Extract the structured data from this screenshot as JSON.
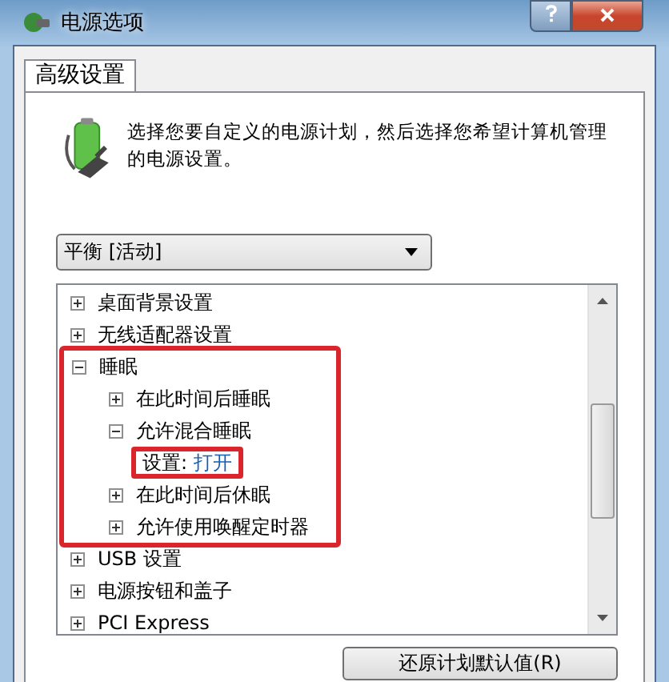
{
  "window": {
    "title": "电源选项"
  },
  "tabs": [
    {
      "label": "高级设置",
      "selected": true
    }
  ],
  "description": "选择您要自定义的电源计划，然后选择您希望计算机管理的电源设置。",
  "plan_select": {
    "value": "平衡 [活动]"
  },
  "settings_tree": [
    {
      "kind": "group",
      "label": "桌面背景设置",
      "expanded": false,
      "highlighted": false
    },
    {
      "kind": "group",
      "label": "无线适配器设置",
      "expanded": false,
      "highlighted": false
    },
    {
      "kind": "group",
      "label": "睡眠",
      "expanded": true,
      "highlighted": true,
      "children": [
        {
          "kind": "group",
          "label": "在此时间后睡眠",
          "expanded": false,
          "highlighted": false
        },
        {
          "kind": "group",
          "label": "允许混合睡眠",
          "expanded": true,
          "highlighted": false,
          "children": [
            {
              "kind": "setting",
              "label": "设置:",
              "value": "打开",
              "highlighted": true
            }
          ]
        },
        {
          "kind": "group",
          "label": "在此时间后休眠",
          "expanded": false,
          "highlighted": false
        },
        {
          "kind": "group",
          "label": "允许使用唤醒定时器",
          "expanded": false,
          "highlighted": false
        }
      ]
    },
    {
      "kind": "group",
      "label": "USB 设置",
      "expanded": false,
      "highlighted": false
    },
    {
      "kind": "group",
      "label": "电源按钮和盖子",
      "expanded": false,
      "highlighted": false
    },
    {
      "kind": "group",
      "label": "PCI Express",
      "expanded": false,
      "highlighted": false
    }
  ],
  "buttons": [
    {
      "label": "还原计划默认值(R)"
    }
  ]
}
